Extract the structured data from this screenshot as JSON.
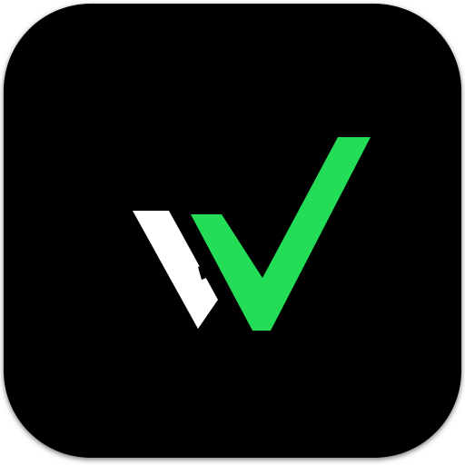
{
  "app_icon": {
    "name": "logo-mark",
    "colors": {
      "tile_background": "#000000",
      "left_stroke": "#ffffff",
      "check_stroke": "#22dd55",
      "page_background": "#ffffff"
    }
  }
}
